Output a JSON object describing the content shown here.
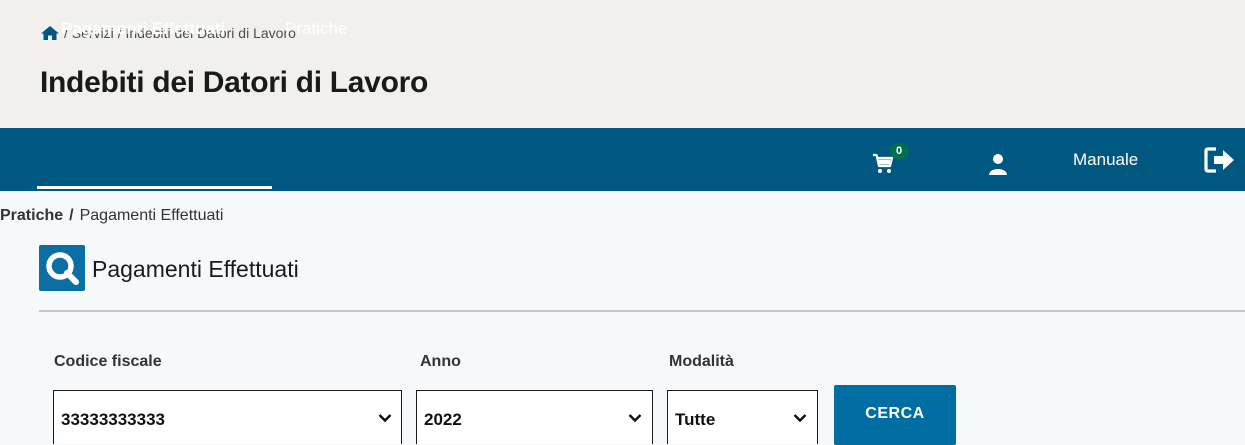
{
  "breadcrumb_top": {
    "items": [
      "Servizi",
      "Indebiti dei Datori di Lavoro"
    ],
    "separator": "/"
  },
  "page_title": "Indebiti dei Datori di Lavoro",
  "nav": {
    "tabs": [
      {
        "label": "Pagamenti Effettuati",
        "active": true
      },
      {
        "label": "Pratiche",
        "active": false
      }
    ],
    "cart_count": "0",
    "manual_label": "Manuale"
  },
  "sub_breadcrumb": {
    "first": "Pratiche",
    "separator": "/",
    "current": "Pagamenti Effettuati"
  },
  "section": {
    "title": "Pagamenti Effettuati",
    "icon": "search-icon"
  },
  "filters": {
    "codice_fiscale": {
      "label": "Codice fiscale",
      "value": "33333333333"
    },
    "anno": {
      "label": "Anno",
      "value": "2022"
    },
    "modalita": {
      "label": "Modalità",
      "value": "Tutte"
    }
  },
  "search_button": "CERCA",
  "colors": {
    "navbar": "#005780",
    "accent": "#006ea3",
    "header_bg": "#f1f0ec",
    "badge": "#00704a"
  }
}
